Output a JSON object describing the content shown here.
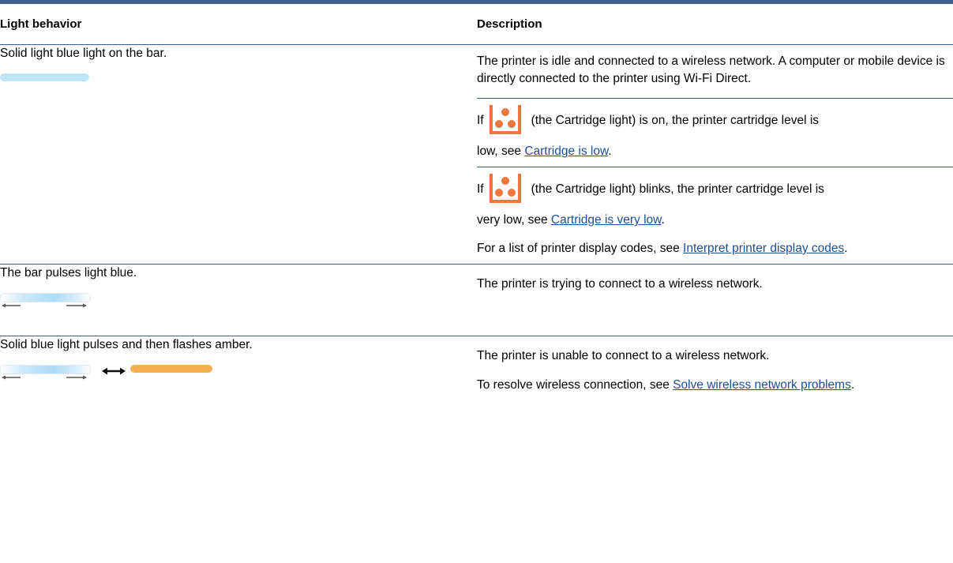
{
  "table": {
    "headers": {
      "behavior": "Light behavior",
      "description": "Description"
    },
    "rows": [
      {
        "behavior": "Solid light blue light on the bar.",
        "descriptions": [
          {
            "text": "The printer is idle and connected to a wireless network. A computer or mobile device is directly connected to the printer using Wi-Fi Direct."
          },
          {
            "prefix": "If",
            "icon": "cartridge-light-icon",
            "middle": "(the Cartridge light) is on, the printer cartridge level is",
            "suffix": "low, see",
            "link": "Cartridge is low",
            "end": "."
          },
          {
            "prefix": "If",
            "icon": "cartridge-light-icon",
            "middle": "(the Cartridge light) blinks, the printer cartridge level is",
            "suffix": "very low, see",
            "link": "Cartridge is very low",
            "end": "."
          },
          {
            "prefix": "For a list of printer display codes, see",
            "link": "Interpret printer display codes",
            "end": "."
          }
        ]
      },
      {
        "behavior": "The bar pulses light blue.",
        "description": "The printer is trying to connect to a wireless network."
      },
      {
        "behavior": "Solid blue light pulses and then flashes amber.",
        "description": "The printer is unable to connect to a wireless network.",
        "extra_prefix": "To resolve wireless connection, see",
        "extra_link": "Solve wireless network problems",
        "extra_end": "."
      }
    ]
  },
  "colors": {
    "rule": "#3d5e8e",
    "link": "#1d4f91",
    "light_blue": "#bfe3f7",
    "amber": "#f7b04f",
    "cartridge_orange": "#f0763f"
  }
}
